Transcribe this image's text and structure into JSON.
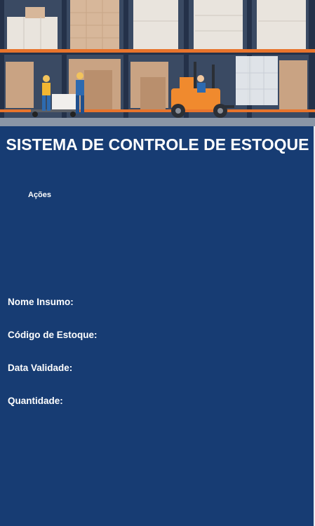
{
  "app": {
    "title": "SISTEMA DE CONTROLE DE ESTOQUE"
  },
  "hero": {
    "illustration": "warehouse-illustration"
  },
  "actions": {
    "label": "Ações"
  },
  "form": {
    "fields": [
      {
        "label": "Nome Insumo:"
      },
      {
        "label": "Código de Estoque:"
      },
      {
        "label": "Data Validade:"
      },
      {
        "label": "Quantidade:"
      }
    ]
  },
  "colors": {
    "background": "#173c73",
    "text": "#ffffff",
    "shelf_orange": "#e8742c",
    "forklift_orange": "#f08a2e"
  }
}
